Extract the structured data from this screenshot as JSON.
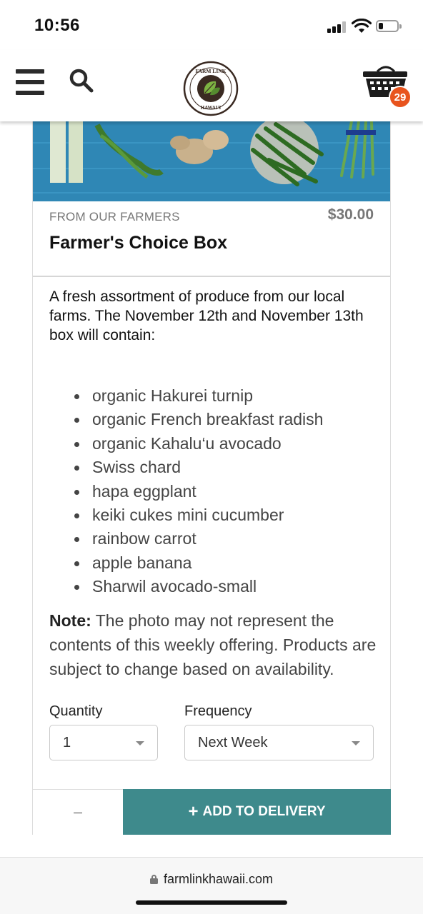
{
  "status_bar": {
    "time": "10:56"
  },
  "header": {
    "cart_count": "29"
  },
  "product": {
    "category": "FROM OUR FARMERS",
    "price": "$30.00",
    "title": "Farmer's Choice Box",
    "description": "A fresh assortment of produce from our local farms. The November 12th and November 13th box will contain:",
    "items": [
      "organic Hakurei turnip",
      "organic French breakfast radish",
      "organic Kahalu‘u avocado",
      "Swiss chard",
      "hapa eggplant",
      "keiki cukes mini cucumber",
      "rainbow carrot",
      "apple banana",
      "Sharwil avocado-small"
    ],
    "note_label": "Note:",
    "note_text": " The photo may not represent the contents of this weekly offering. Products are subject to change based on availability."
  },
  "form": {
    "quantity_label": "Quantity",
    "quantity_value": "1",
    "frequency_label": "Frequency",
    "frequency_value": "Next Week",
    "minus_label": "–",
    "add_label": "ADD TO DELIVERY"
  },
  "browser": {
    "url": "farmlinkhawaii.com"
  },
  "colors": {
    "accent": "#3e8a8c",
    "badge": "#e8541e",
    "hero_bg": "#2f87b5"
  }
}
